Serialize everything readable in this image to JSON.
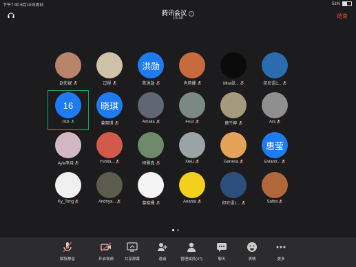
{
  "status": {
    "left": "下午7:40  6月10日周日",
    "right": "51%"
  },
  "header": {
    "title": "腾讯会议",
    "time": "15:49",
    "end_label": "结束"
  },
  "participants": [
    {
      "name": "赵彩妮",
      "avatar_text": "",
      "color": "#b9826a"
    },
    {
      "name": "过程",
      "avatar_text": "",
      "color": "#d0c2a8"
    },
    {
      "name": "陈洪勋",
      "avatar_text": "洪勋",
      "color": "#1f7bf2"
    },
    {
      "name": "肖莉姗",
      "avatar_text": "",
      "color": "#c86b3c"
    },
    {
      "name": "Mira张...",
      "avatar_text": "",
      "color": "#0b0b0b"
    },
    {
      "name": "印尼语1...",
      "avatar_text": "",
      "color": "#2b6cb0"
    },
    {
      "name": "016",
      "avatar_text": "16",
      "color": "#1f7bf2"
    },
    {
      "name": "曾晓琪",
      "avatar_text": "晓琪",
      "color": "#1f7bf2"
    },
    {
      "name": "Amalia",
      "avatar_text": "",
      "color": "#5e6772"
    },
    {
      "name": "Four",
      "avatar_text": "",
      "color": "#7a8a82"
    },
    {
      "name": "颜千粹",
      "avatar_text": "",
      "color": "#a49a7c"
    },
    {
      "name": "Ara",
      "avatar_text": "",
      "color": "#8f8f8f"
    },
    {
      "name": "Ayla李月",
      "avatar_text": "",
      "color": "#d3b7c3"
    },
    {
      "name": "Yunita...",
      "avatar_text": "",
      "color": "#d35a4a"
    },
    {
      "name": "柯雅真",
      "avatar_text": "",
      "color": "#6f8a6a"
    },
    {
      "name": "XieLi",
      "avatar_text": "",
      "color": "#9aa3a8"
    },
    {
      "name": "Ganesa",
      "avatar_text": "",
      "color": "#e3a45a"
    },
    {
      "name": "Evlanti...",
      "avatar_text": "惠莹",
      "color": "#1f7bf2"
    },
    {
      "name": "Ky_Tong",
      "avatar_text": "",
      "color": "#f0f0f0"
    },
    {
      "name": "Andriya...",
      "avatar_text": "",
      "color": "#5c5c4c"
    },
    {
      "name": "慕晓珊",
      "avatar_text": "",
      "color": "#f4f4f4"
    },
    {
      "name": "Ananta",
      "avatar_text": "",
      "color": "#f2d01c"
    },
    {
      "name": "印尼语1...",
      "avatar_text": "",
      "color": "#2d4f7a"
    },
    {
      "name": "Safira",
      "avatar_text": "",
      "color": "#b0673a"
    }
  ],
  "toolbar": [
    {
      "label": "解除静音",
      "icon": "mic-muted-icon"
    },
    {
      "label": "开启视频",
      "icon": "video-off-icon"
    },
    {
      "label": "共享屏幕",
      "icon": "share-screen-icon"
    },
    {
      "label": "邀请",
      "icon": "invite-icon"
    },
    {
      "label": "管理成员(47)",
      "icon": "members-icon"
    },
    {
      "label": "聊天",
      "icon": "chat-icon"
    },
    {
      "label": "表情",
      "icon": "emoji-icon"
    },
    {
      "label": "更多",
      "icon": "more-icon"
    }
  ],
  "pager": {
    "pages": 2,
    "current": 1
  }
}
